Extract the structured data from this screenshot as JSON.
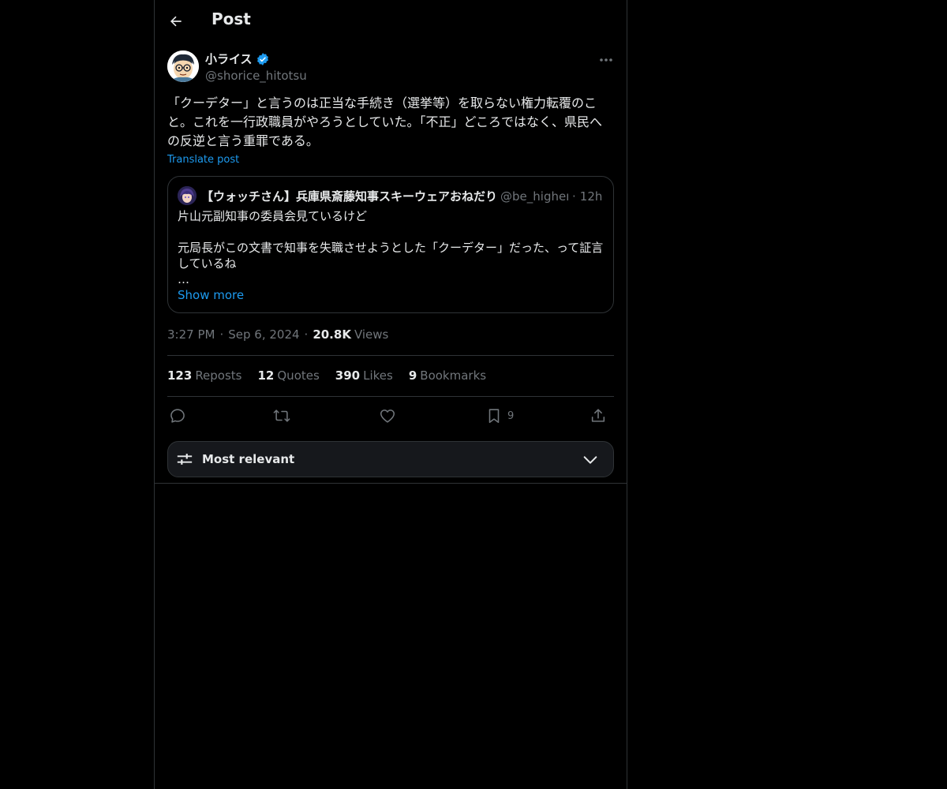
{
  "header": {
    "title": "Post"
  },
  "author": {
    "display_name": "小ライス",
    "handle": "@shorice_hitotsu",
    "verified": true
  },
  "post": {
    "text": "「クーデター」と言うのは正当な手続き（選挙等）を取らない権力転覆のこと。これを一行政職員がやろうとしていた。「不正」どころではなく、県民への反逆と言う重罪である。",
    "translate_label": "Translate post"
  },
  "quote": {
    "display_name": "【ウォッチさん】兵庫県斎藤知事スキーウェアおねだり",
    "handle": "@be_higher_",
    "time": "12h",
    "text": "片山元副知事の委員会見ているけど\n\n元局長がこの文書で知事を失職させようとした「クーデター」だった、って証言しているね\n…",
    "show_more": "Show more"
  },
  "meta": {
    "time": "3:27 PM",
    "date": "Sep 6, 2024",
    "views_count": "20.8K",
    "views_label": "Views"
  },
  "stats": [
    {
      "count": "123",
      "label": "Reposts"
    },
    {
      "count": "12",
      "label": "Quotes"
    },
    {
      "count": "390",
      "label": "Likes"
    },
    {
      "count": "9",
      "label": "Bookmarks"
    }
  ],
  "actions": {
    "bookmark_count": "9"
  },
  "sort": {
    "label": "Most relevant"
  },
  "colors": {
    "accent": "#1d9bf0",
    "background": "#000000",
    "border": "#2f3336",
    "muted": "#71767b"
  }
}
